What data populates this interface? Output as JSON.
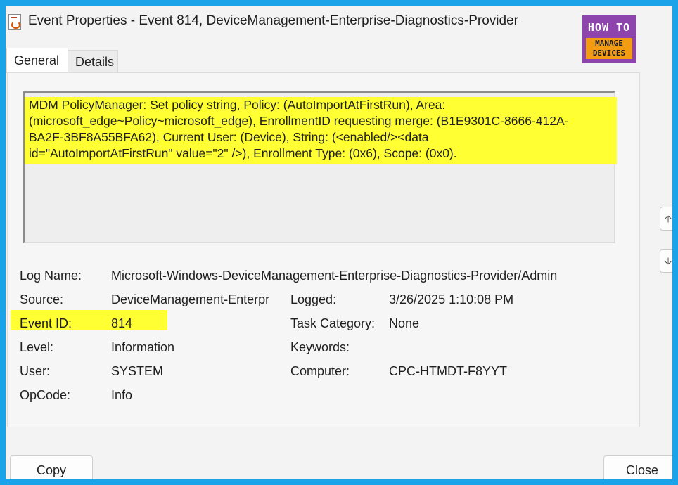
{
  "window": {
    "title": "Event Properties - Event 814, DeviceManagement-Enterprise-Diagnostics-Provider"
  },
  "logo": {
    "top": "HOW TO",
    "bottom_line1": "MANAGE",
    "bottom_line2": "DEVICES",
    "colors": {
      "top_bg": "#8e44ad",
      "bottom_bg": "#f39c12"
    }
  },
  "tabs": [
    {
      "label": "General",
      "selected": true
    },
    {
      "label": "Details",
      "selected": false
    }
  ],
  "description": {
    "text": "MDM PolicyManager: Set policy string, Policy: (AutoImportAtFirstRun), Area:\n(microsoft_edge~Policy~microsoft_edge), EnrollmentID requesting merge: (B1E9301C-8666-412A-\nBA2F-3BF8A55BFA62), Current User: (Device), String: (<enabled/><data\nid=\"AutoImportAtFirstRun\" value=\"2\" />), Enrollment Type: (0x6), Scope: (0x0).",
    "highlight_color": "#ffff33"
  },
  "fields": {
    "log_name": {
      "label": "Log Name:",
      "value": "Microsoft-Windows-DeviceManagement-Enterprise-Diagnostics-Provider/Admin"
    },
    "source": {
      "label": "Source:",
      "value": "DeviceManagement-Enterpr"
    },
    "logged": {
      "label": "Logged:",
      "value": "3/26/2025 1:10:08 PM"
    },
    "event_id": {
      "label": "Event ID:",
      "value": "814"
    },
    "task_category": {
      "label": "Task Category:",
      "value": "None"
    },
    "level": {
      "label": "Level:",
      "value": "Information"
    },
    "keywords": {
      "label": "Keywords:",
      "value": ""
    },
    "user": {
      "label": "User:",
      "value": "SYSTEM"
    },
    "computer": {
      "label": "Computer:",
      "value": "CPC-HTMDT-F8YYT"
    },
    "opcode": {
      "label": "OpCode:",
      "value": "Info"
    }
  },
  "side_buttons": {
    "up": "🡡",
    "down": "🡣"
  },
  "buttons": {
    "copy": "Copy",
    "close": "Close"
  },
  "colors": {
    "frame": "#1aa3e8",
    "window_bg": "#f3f3f3"
  }
}
